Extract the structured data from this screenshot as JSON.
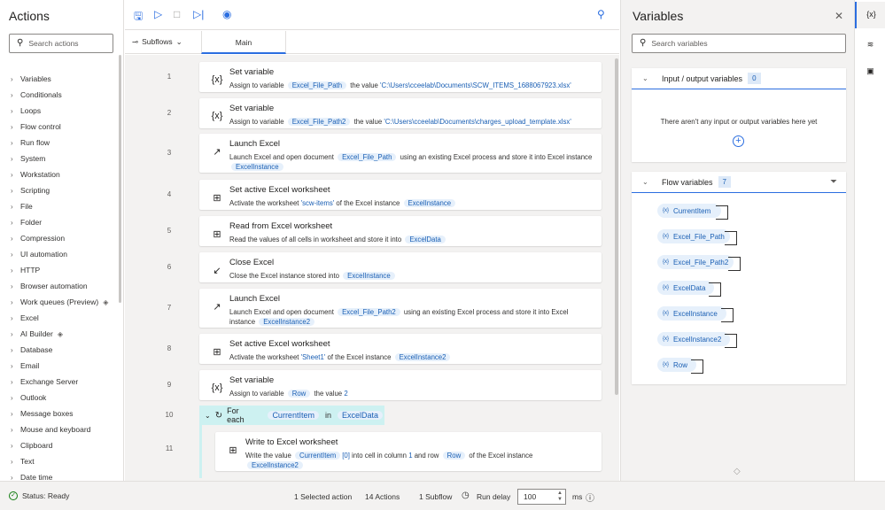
{
  "actions_panel": {
    "title": "Actions",
    "search_placeholder": "Search actions",
    "items": [
      {
        "label": "Variables"
      },
      {
        "label": "Conditionals"
      },
      {
        "label": "Loops"
      },
      {
        "label": "Flow control"
      },
      {
        "label": "Run flow"
      },
      {
        "label": "System"
      },
      {
        "label": "Workstation"
      },
      {
        "label": "Scripting"
      },
      {
        "label": "File"
      },
      {
        "label": "Folder"
      },
      {
        "label": "Compression"
      },
      {
        "label": "UI automation"
      },
      {
        "label": "HTTP"
      },
      {
        "label": "Browser automation"
      },
      {
        "label": "Work queues (Preview)",
        "icon": "premium-icon"
      },
      {
        "label": "Excel"
      },
      {
        "label": "AI Builder",
        "icon": "premium-icon"
      },
      {
        "label": "Database"
      },
      {
        "label": "Email"
      },
      {
        "label": "Exchange Server"
      },
      {
        "label": "Outlook"
      },
      {
        "label": "Message boxes"
      },
      {
        "label": "Mouse and keyboard"
      },
      {
        "label": "Clipboard"
      },
      {
        "label": "Text"
      },
      {
        "label": "Date time"
      }
    ]
  },
  "tabs": {
    "subflows": "Subflows",
    "main": "Main"
  },
  "steps": [
    {
      "n": "1",
      "icon": "{x}",
      "title": "Set variable",
      "parts": [
        [
          "t",
          "Assign to variable "
        ],
        [
          "c",
          "Excel_File_Path"
        ],
        [
          "t",
          " the value "
        ],
        [
          "l",
          "'C:\\Users\\cceelab\\Documents\\SCW_ITEMS_1688067923.xlsx'"
        ]
      ]
    },
    {
      "n": "2",
      "icon": "{x}",
      "title": "Set variable",
      "parts": [
        [
          "t",
          "Assign to variable "
        ],
        [
          "c",
          "Excel_File_Path2"
        ],
        [
          "t",
          " the value "
        ],
        [
          "l",
          "'C:\\Users\\cceelab\\Documents\\charges_upload_template.xlsx'"
        ]
      ]
    },
    {
      "n": "3",
      "icon": "↗",
      "title": "Launch Excel",
      "parts": [
        [
          "t",
          "Launch Excel and open document "
        ],
        [
          "c",
          "Excel_File_Path"
        ],
        [
          "t",
          " using an existing Excel process and store it into Excel instance "
        ],
        [
          "c",
          "ExcelInstance"
        ]
      ]
    },
    {
      "n": "4",
      "icon": "⊞",
      "title": "Set active Excel worksheet",
      "parts": [
        [
          "t",
          "Activate the worksheet "
        ],
        [
          "l",
          "'scw-items'"
        ],
        [
          "t",
          " of the Excel instance "
        ],
        [
          "c",
          "ExcelInstance"
        ]
      ]
    },
    {
      "n": "5",
      "icon": "⊞",
      "title": "Read from Excel worksheet",
      "parts": [
        [
          "t",
          "Read the values of all cells in worksheet and store it into "
        ],
        [
          "c",
          "ExcelData"
        ]
      ]
    },
    {
      "n": "6",
      "icon": "↙",
      "title": "Close Excel",
      "parts": [
        [
          "t",
          "Close the Excel instance stored into "
        ],
        [
          "c",
          "ExcelInstance"
        ]
      ]
    },
    {
      "n": "7",
      "icon": "↗",
      "title": "Launch Excel",
      "parts": [
        [
          "t",
          "Launch Excel and open document "
        ],
        [
          "c",
          "Excel_File_Path2"
        ],
        [
          "t",
          " using an existing Excel process and store it into Excel instance "
        ],
        [
          "c",
          "ExcelInstance2"
        ]
      ]
    },
    {
      "n": "8",
      "icon": "⊞",
      "title": "Set active Excel worksheet",
      "parts": [
        [
          "t",
          "Activate the worksheet "
        ],
        [
          "l",
          "'Sheet1'"
        ],
        [
          "t",
          " of the Excel instance "
        ],
        [
          "c",
          "ExcelInstance2"
        ]
      ]
    },
    {
      "n": "9",
      "icon": "{x}",
      "title": "Set variable",
      "parts": [
        [
          "t",
          "Assign to variable "
        ],
        [
          "c",
          "Row"
        ],
        [
          "t",
          " the value "
        ],
        [
          "l",
          "2"
        ]
      ]
    }
  ],
  "foreach": {
    "n": "10",
    "label": "For each",
    "var": "CurrentItem",
    "in": "in",
    "list": "ExcelData"
  },
  "nested_step": {
    "n": "11",
    "icon": "⊞",
    "title": "Write to Excel worksheet",
    "parts": [
      [
        "t",
        "Write the value "
      ],
      [
        "c",
        "CurrentItem"
      ],
      [
        "l",
        "[0]"
      ],
      [
        "t",
        " into cell in column "
      ],
      [
        "l",
        "1"
      ],
      [
        "t",
        " and row "
      ],
      [
        "c",
        "Row"
      ],
      [
        "t",
        " of the Excel instance "
      ],
      [
        "c",
        "ExcelInstance2"
      ]
    ]
  },
  "variables_panel": {
    "title": "Variables",
    "search_placeholder": "Search variables",
    "io_section": {
      "title": "Input / output variables",
      "count": "0",
      "empty_text": "There aren't any input or output variables here yet"
    },
    "flow_section": {
      "title": "Flow variables",
      "count": "7",
      "vars": [
        "CurrentItem",
        "Excel_File_Path",
        "Excel_File_Path2",
        "ExcelData",
        "ExcelInstance",
        "ExcelInstance2",
        "Row"
      ]
    }
  },
  "rail": {
    "vars": "{x}"
  },
  "status": {
    "ready": "Status: Ready",
    "selected": "1 Selected action",
    "actions": "14 Actions",
    "subflows": "1 Subflow",
    "run_delay_label": "Run delay",
    "run_delay_value": "100",
    "unit": "ms"
  }
}
